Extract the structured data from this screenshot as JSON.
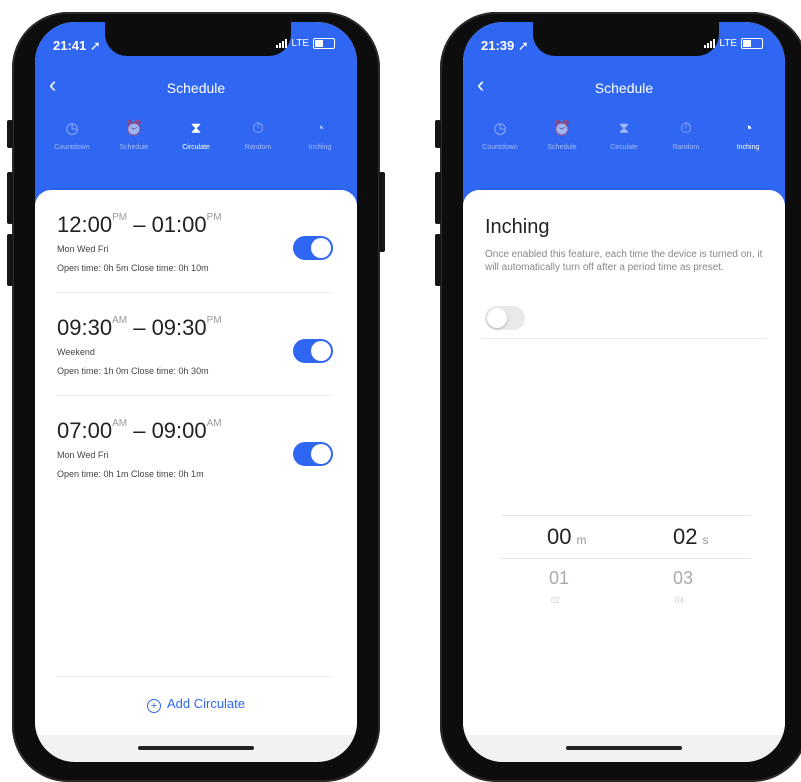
{
  "colors": {
    "accent": "#2f66f2"
  },
  "left": {
    "status_time": "21:41",
    "status_icon": "location-arrow-icon",
    "network": "LTE",
    "nav_title": "Schedule",
    "tabs": [
      {
        "label": "Countdown",
        "icon": "clock-icon"
      },
      {
        "label": "Schedule",
        "icon": "alarm-clock-icon"
      },
      {
        "label": "Circulate",
        "icon": "hourglass-icon"
      },
      {
        "label": "Random",
        "icon": "stopwatch-icon"
      },
      {
        "label": "Inching",
        "icon": "timer-icon"
      }
    ],
    "active_tab": "Circulate",
    "schedules": [
      {
        "start": "12:00",
        "start_ampm": "PM",
        "dash": "–",
        "end": "01:00",
        "end_ampm": "PM",
        "days": "Mon Wed Fri",
        "info": "Open time: 0h 5m   Close time: 0h 10m",
        "enabled": true
      },
      {
        "start": "09:30",
        "start_ampm": "AM",
        "dash": "–",
        "end": "09:30",
        "end_ampm": "PM",
        "days": "Weekend",
        "info": "Open time: 1h 0m   Close time: 0h 30m",
        "enabled": true
      },
      {
        "start": "07:00",
        "start_ampm": "AM",
        "dash": "–",
        "end": "09:00",
        "end_ampm": "AM",
        "days": "Mon Wed Fri",
        "info": "Open time: 0h 1m   Close time: 0h 1m",
        "enabled": true
      }
    ],
    "add_label": "Add Circulate"
  },
  "right": {
    "status_time": "21:39",
    "status_icon": "location-arrow-icon",
    "network": "LTE",
    "nav_title": "Schedule",
    "tabs": [
      {
        "label": "Countdown",
        "icon": "clock-icon"
      },
      {
        "label": "Schedule",
        "icon": "alarm-clock-icon"
      },
      {
        "label": "Circulate",
        "icon": "hourglass-icon"
      },
      {
        "label": "Random",
        "icon": "stopwatch-icon"
      },
      {
        "label": "Inching",
        "icon": "timer-icon"
      }
    ],
    "active_tab": "Inching",
    "inching_title": "Inching",
    "inching_desc": "Once enabled this feature,  each time the device is turned on, it will automatically turn off after a period time as preset.",
    "inching_enabled": false,
    "picker": {
      "minutes": {
        "selected": "00",
        "unit": "m",
        "next": "01",
        "next2": "02"
      },
      "seconds": {
        "selected": "02",
        "unit": "s",
        "next": "03",
        "next2": "04"
      }
    }
  }
}
